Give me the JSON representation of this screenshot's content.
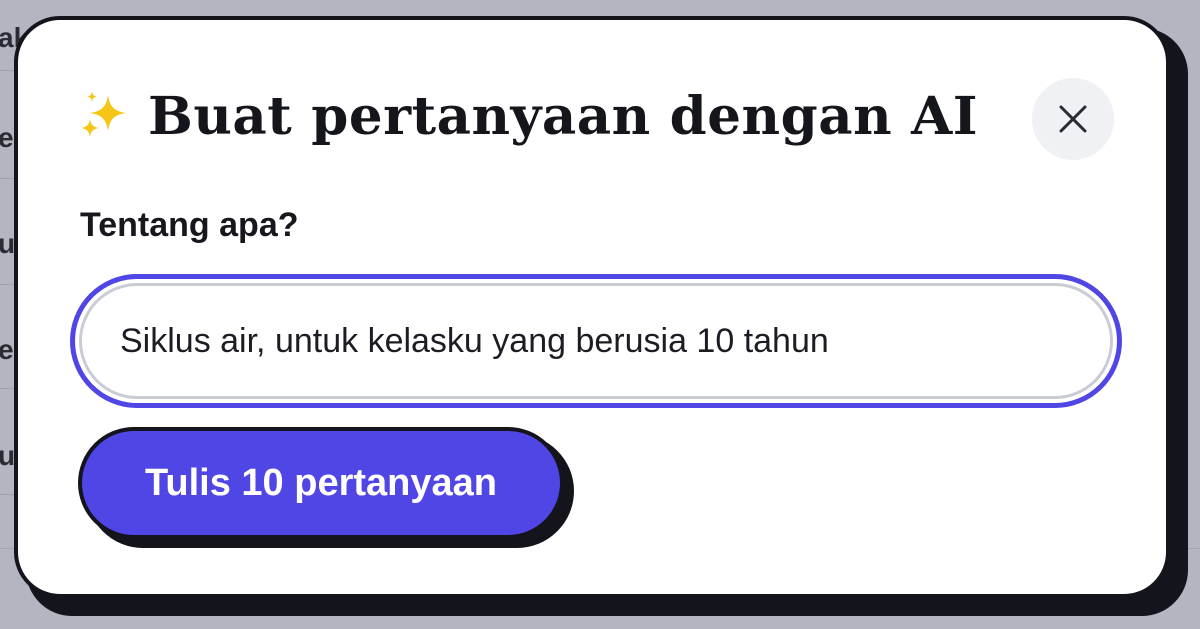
{
  "background": {
    "fragments": [
      "ak",
      "e",
      "uj",
      "e",
      "u"
    ]
  },
  "modal": {
    "title": "Buat pertanyaan dengan AI",
    "title_icon": "sparkles-icon",
    "close_icon": "close-icon",
    "field_label": "Tentang apa?",
    "topic_value": "Siklus air, untuk kelasku yang berusia 10 tahun",
    "generate_label": "Tulis 10 pertanyaan"
  },
  "colors": {
    "accent": "#5046e6",
    "sparkle": "#f5c518",
    "ink": "#14151c"
  }
}
